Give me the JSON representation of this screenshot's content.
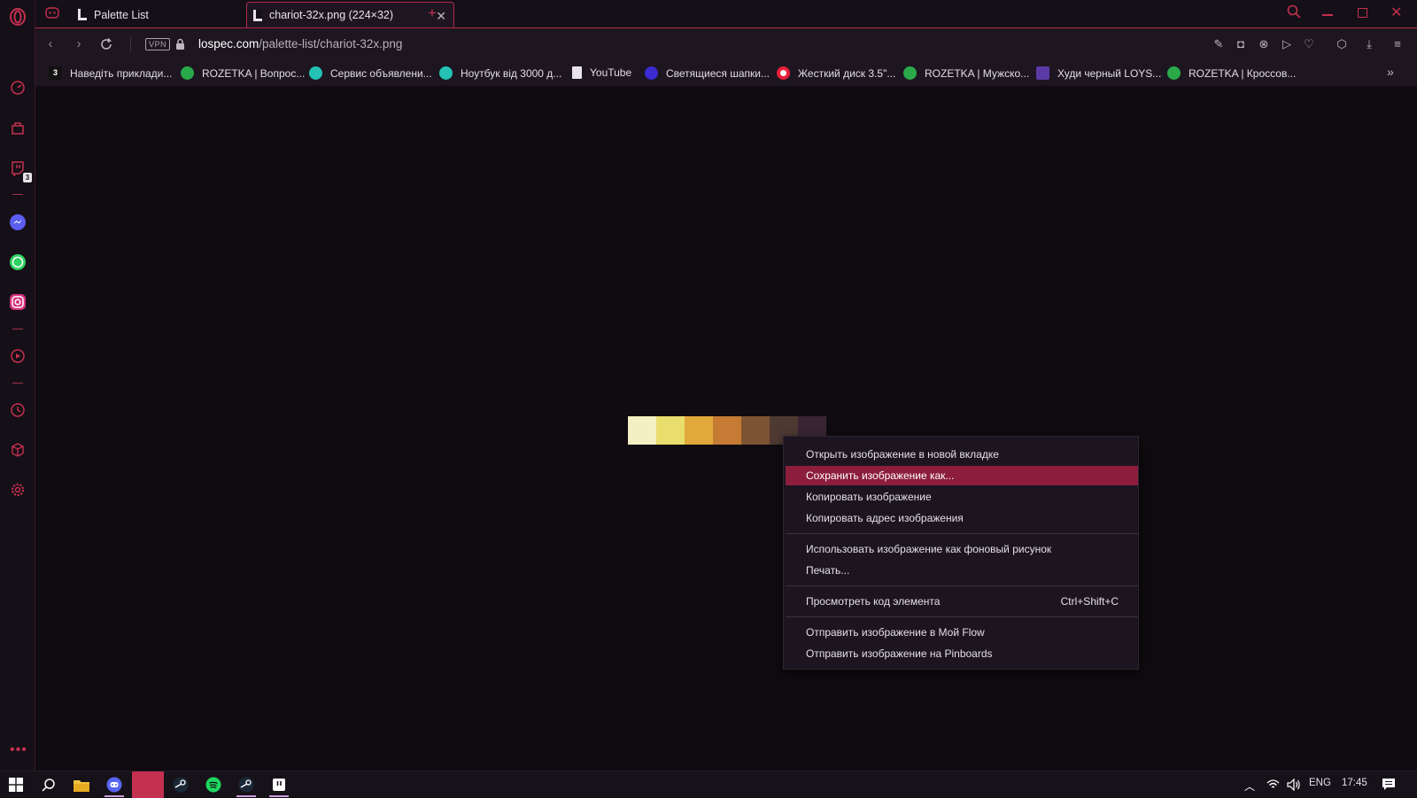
{
  "tabs": [
    {
      "title": "Palette List",
      "icon": "lospec-favicon"
    },
    {
      "title": "chariot-32x.png (224×32)",
      "icon": "lospec-favicon",
      "active": true
    }
  ],
  "address": {
    "domain": "lospec.com",
    "path": "/palette-list/chariot-32x.png",
    "vpn_label": "VPN"
  },
  "bookmarks": [
    {
      "label": "Наведіть приклади...",
      "icon": "number-3-icon",
      "color": "#111111"
    },
    {
      "label": "ROZETKA | Вопрос...",
      "icon": "rozetka-icon",
      "color": "#2aa94a"
    },
    {
      "label": "Сервис объявлени...",
      "icon": "olx-icon",
      "color": "#23c2b4"
    },
    {
      "label": "Ноутбук від 3000 д...",
      "icon": "olx-icon",
      "color": "#23c2b4"
    },
    {
      "label": "YouTube",
      "icon": "page-icon",
      "color": "#e8e3e9"
    },
    {
      "label": "Светящиеся шапки...",
      "icon": "site-icon",
      "color": "#3b2bd1"
    },
    {
      "label": "Жесткий диск 3.5\"...",
      "icon": "target-icon",
      "color": "#e8203a"
    },
    {
      "label": "ROZETKA | Мужско...",
      "icon": "rozetka-icon",
      "color": "#2aa94a"
    },
    {
      "label": "Худи черный LOYS...",
      "icon": "square-icon",
      "color": "#5b3aa8"
    },
    {
      "label": "ROZETKA | Кроссов...",
      "icon": "rozetka-icon",
      "color": "#2aa94a"
    }
  ],
  "palette": [
    "#f4f0c3",
    "#e9dd6e",
    "#e1a93b",
    "#c57b34",
    "#7c5433",
    "#4f3a33",
    "#3a2632"
  ],
  "context_menu": {
    "items": [
      {
        "label": "Открыть изображение в новой вкладке"
      },
      {
        "label": "Сохранить изображение как...",
        "highlighted": true
      },
      {
        "label": "Копировать изображение"
      },
      {
        "label": "Копировать адрес изображения"
      },
      {
        "label": "Использовать изображение как фоновый рисунок"
      },
      {
        "label": "Печать..."
      },
      {
        "label": "Просмотреть код элемента",
        "shortcut": "Ctrl+Shift+C"
      },
      {
        "label": "Отправить изображение в Мой Flow"
      },
      {
        "label": "Отправить изображение на Pinboards"
      }
    ]
  },
  "sidebar": {
    "twitch_badge": "3"
  },
  "tray": {
    "language": "ENG",
    "time": "17:45"
  },
  "colors": {
    "accent": "#b02a4e",
    "highlight": "#8c1d3c",
    "background": "#0f0b10"
  }
}
